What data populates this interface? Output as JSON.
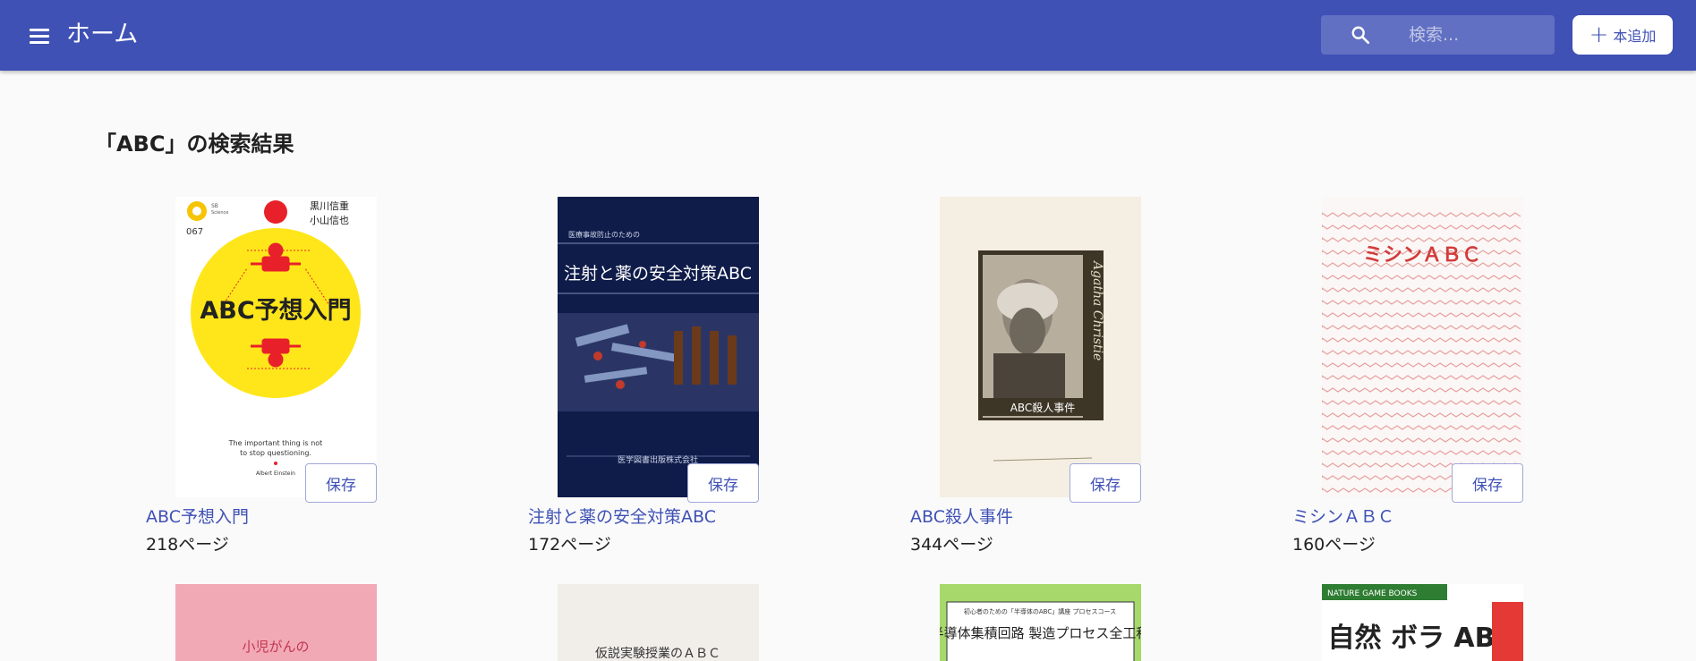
{
  "header": {
    "title": "ホーム",
    "search_placeholder": "検索...",
    "add_button_label": "本追加"
  },
  "results": {
    "heading": "「ABC」の検索結果"
  },
  "books": [
    {
      "title": "ABC予想入門",
      "pages": "218ページ",
      "save_label": "保存",
      "cover": {
        "series_no": "067",
        "authors": [
          "黒川信重",
          "小山信也"
        ],
        "title": "ABC予想入門",
        "quote": [
          "The important thing is not",
          "to stop questioning."
        ],
        "quote_author": "Albert Einstein"
      }
    },
    {
      "title": "注射と薬の安全対策ABC",
      "pages": "172ページ",
      "save_label": "保存",
      "cover": {
        "subtitle": "医療事故防止のための",
        "title": "注射と薬の安全対策ABC",
        "publisher": "医学図書出版株式会社"
      }
    },
    {
      "title": "ABC殺人事件",
      "pages": "344ページ",
      "save_label": "保存",
      "cover": {
        "label": "ABC殺人事件",
        "spine_text": "Agatha Christie"
      }
    },
    {
      "title": "ミシンＡＢＣ",
      "pages": "160ページ",
      "save_label": "保存",
      "cover": {
        "title": "ミシンＡＢＣ"
      }
    }
  ],
  "second_row_covers": [
    {
      "text": "小児がんの"
    },
    {
      "text": "仮説実験授業のＡＢＣ"
    },
    {
      "top": "初心者のための「半導体のABC」講座 プロセスコース",
      "text": "半導体集積回路 製造プロセス全工程"
    },
    {
      "band": "NATURE GAME BOOKS",
      "text": "自然 ボラ AB"
    }
  ],
  "colors": {
    "primary": "#3f51b5",
    "background": "#fafafa"
  }
}
